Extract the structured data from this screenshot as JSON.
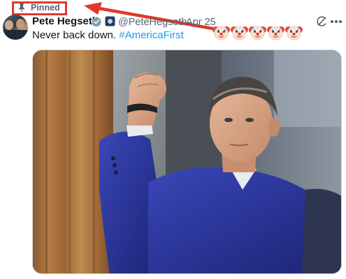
{
  "pinned": {
    "label": "Pinned",
    "icon": "pin-icon"
  },
  "annotation": {
    "box_color": "#e0392b",
    "arrow_color": "#e0392b"
  },
  "tweet": {
    "author": {
      "display_name": "Pete Hegseth",
      "handle": "@PeteHegseth",
      "verified": true,
      "affiliation_badge": true
    },
    "separator": "·",
    "date": "Apr 25",
    "text": "Never back down. ",
    "hashtag": "#AmericaFirst",
    "emojis": [
      "🤡",
      "🤡",
      "🤡",
      "🤡",
      "🤡"
    ],
    "media": {
      "type": "photo"
    }
  },
  "icons": {
    "verified": "verified-badge-icon",
    "grok": "grok-icon",
    "more": "more-options-icon"
  },
  "colors": {
    "text": "#0f1419",
    "secondary": "#536471",
    "link": "#1d9bf0",
    "verified": "#829aab"
  }
}
